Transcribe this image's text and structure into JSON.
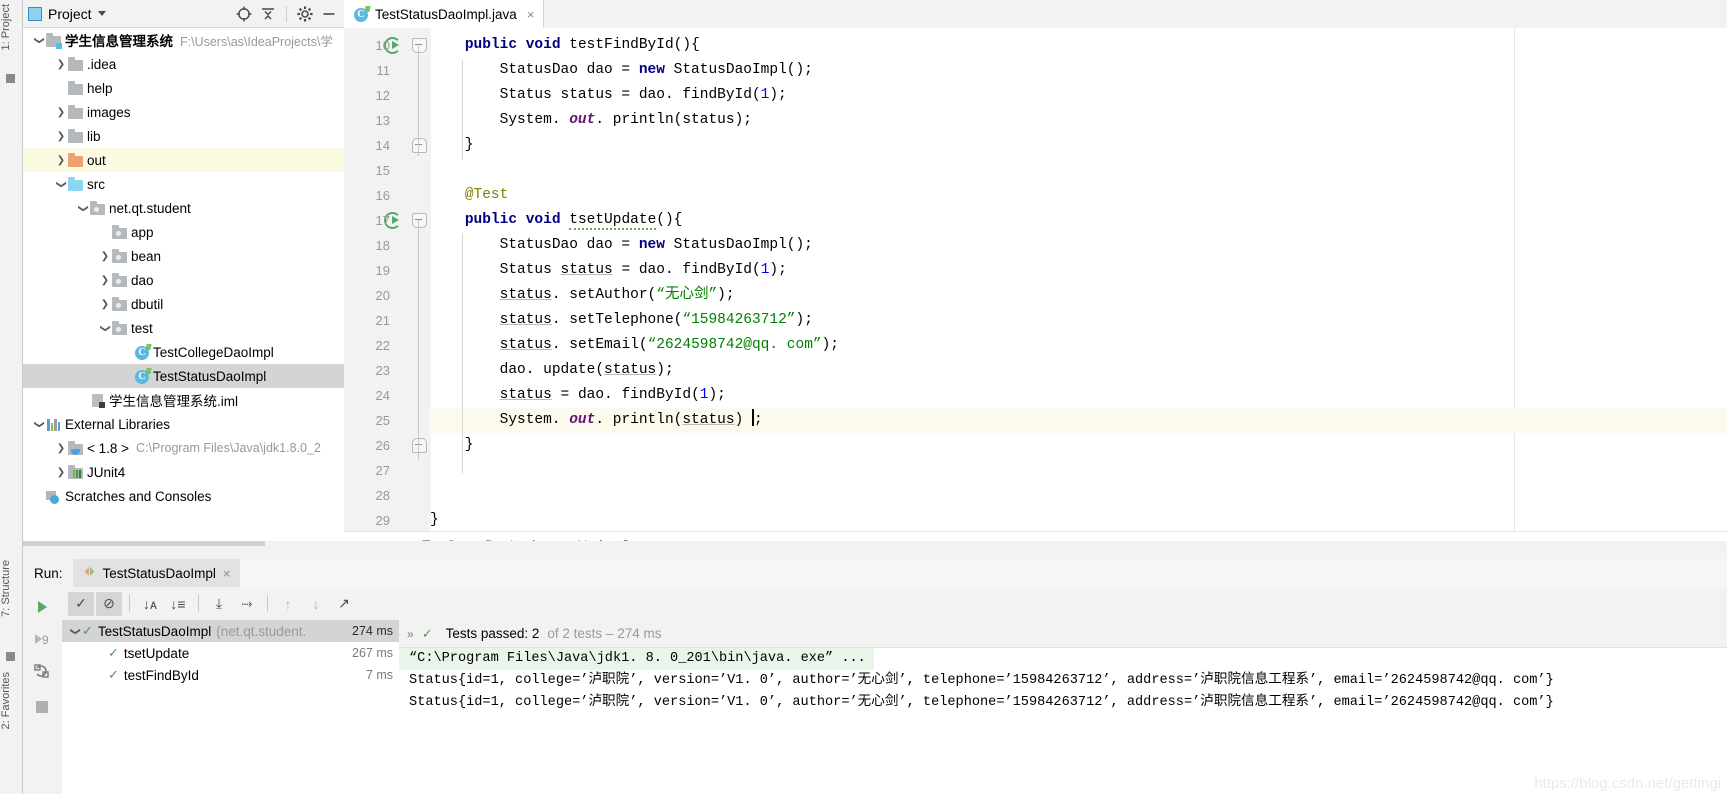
{
  "leftstrip": {
    "items": [
      {
        "name": "project-tool-label",
        "label": "1: Project"
      },
      {
        "name": "structure-tool-label",
        "label": "7: Structure"
      },
      {
        "name": "favorites-tool-label",
        "label": "2: Favorites"
      }
    ]
  },
  "project_panel": {
    "title": "Project",
    "icons": [
      "locate-icon",
      "collapse-all-icon",
      "gear-icon",
      "hide-icon"
    ],
    "tree": [
      {
        "indent": 0,
        "arrow": "down",
        "icon": "folder-module-icon",
        "label": "学生信息管理系统",
        "path": "F:\\Users\\as\\IdeaProjects\\学",
        "bold": true,
        "state": "normal"
      },
      {
        "indent": 1,
        "arrow": "right",
        "icon": "folder-icon",
        "label": ".idea",
        "path": "",
        "bold": false,
        "state": "normal"
      },
      {
        "indent": 1,
        "arrow": "none",
        "icon": "folder-icon",
        "label": "help",
        "path": "",
        "bold": false,
        "state": "normal"
      },
      {
        "indent": 1,
        "arrow": "right",
        "icon": "folder-icon",
        "label": "images",
        "path": "",
        "bold": false,
        "state": "normal"
      },
      {
        "indent": 1,
        "arrow": "right",
        "icon": "folder-icon",
        "label": "lib",
        "path": "",
        "bold": false,
        "state": "normal"
      },
      {
        "indent": 1,
        "arrow": "right",
        "icon": "folder-output-icon",
        "label": "out",
        "path": "",
        "bold": false,
        "state": "highlight"
      },
      {
        "indent": 1,
        "arrow": "down",
        "icon": "folder-source-icon",
        "label": "src",
        "path": "",
        "bold": false,
        "state": "normal"
      },
      {
        "indent": 2,
        "arrow": "down",
        "icon": "package-icon",
        "label": "net.qt.student",
        "path": "",
        "bold": false,
        "state": "normal"
      },
      {
        "indent": 3,
        "arrow": "none",
        "icon": "package-icon",
        "label": "app",
        "path": "",
        "bold": false,
        "state": "normal"
      },
      {
        "indent": 3,
        "arrow": "right",
        "icon": "package-icon",
        "label": "bean",
        "path": "",
        "bold": false,
        "state": "normal"
      },
      {
        "indent": 3,
        "arrow": "right",
        "icon": "package-icon",
        "label": "dao",
        "path": "",
        "bold": false,
        "state": "normal"
      },
      {
        "indent": 3,
        "arrow": "right",
        "icon": "package-icon",
        "label": "dbutil",
        "path": "",
        "bold": false,
        "state": "normal"
      },
      {
        "indent": 3,
        "arrow": "down",
        "icon": "package-icon",
        "label": "test",
        "path": "",
        "bold": false,
        "state": "normal"
      },
      {
        "indent": 4,
        "arrow": "none",
        "icon": "java-class-icon",
        "label": "TestCollegeDaoImpl",
        "path": "",
        "bold": false,
        "state": "normal"
      },
      {
        "indent": 4,
        "arrow": "none",
        "icon": "java-class-icon",
        "label": "TestStatusDaoImpl",
        "path": "",
        "bold": false,
        "state": "selected"
      },
      {
        "indent": 2,
        "arrow": "none",
        "icon": "iml-file-icon",
        "label": "学生信息管理系统.iml",
        "path": "",
        "bold": false,
        "state": "normal"
      },
      {
        "indent": 0,
        "arrow": "down",
        "icon": "external-libraries-icon",
        "label": "External Libraries",
        "path": "",
        "bold": false,
        "state": "normal"
      },
      {
        "indent": 1,
        "arrow": "right",
        "icon": "jdk-icon",
        "label": "< 1.8 >",
        "path": "C:\\Program Files\\Java\\jdk1.8.0_2",
        "bold": false,
        "state": "normal"
      },
      {
        "indent": 1,
        "arrow": "right",
        "icon": "junit-icon",
        "label": "JUnit4",
        "path": "",
        "bold": false,
        "state": "normal"
      },
      {
        "indent": 0,
        "arrow": "none",
        "icon": "scratches-icon",
        "label": "Scratches and Consoles",
        "path": "",
        "bold": false,
        "state": "normal"
      }
    ]
  },
  "editor": {
    "tab": {
      "label": "TestStatusDaoImpl.java",
      "icon": "java-class-icon",
      "close": "×"
    },
    "lines": [
      {
        "n": "10",
        "html": "    <span class=\"kw\">public</span> <span class=\"kw\">void</span> testFindById(){",
        "gutter": "run",
        "fold": "top",
        "caret": false
      },
      {
        "n": "11",
        "html": "        StatusDao dao = <span class=\"kw\">new</span> StatusDaoImpl();",
        "gutter": "",
        "fold": "",
        "caret": false
      },
      {
        "n": "12",
        "html": "        Status status = dao. findById(<span class=\"num\">1</span>);",
        "gutter": "",
        "fold": "",
        "caret": false
      },
      {
        "n": "13",
        "html": "        System. <span class=\"stat\">out</span>. println(status);",
        "gutter": "",
        "fold": "",
        "caret": false
      },
      {
        "n": "14",
        "html": "    }",
        "gutter": "",
        "fold": "bottom",
        "caret": false
      },
      {
        "n": "15",
        "html": "",
        "gutter": "",
        "fold": "",
        "caret": false
      },
      {
        "n": "16",
        "html": "    <span class=\"anno\">@Test</span>",
        "gutter": "",
        "fold": "",
        "caret": false
      },
      {
        "n": "17",
        "html": "    <span class=\"kw\">public</span> <span class=\"kw\">void</span> <span class=\"typo\">tsetUpdate</span>(){",
        "gutter": "run",
        "fold": "top",
        "caret": false
      },
      {
        "n": "18",
        "html": "        StatusDao dao = <span class=\"kw\">new</span> StatusDaoImpl();",
        "gutter": "",
        "fold": "",
        "caret": false
      },
      {
        "n": "19",
        "html": "        Status <span class=\"fld\">status</span> = dao. findById(<span class=\"num\">1</span>);",
        "gutter": "",
        "fold": "",
        "caret": false
      },
      {
        "n": "20",
        "html": "        <span class=\"fld\">status</span>. setAuthor(<span class=\"str\">&ldquo;无心剑&rdquo;</span>);",
        "gutter": "",
        "fold": "",
        "caret": false
      },
      {
        "n": "21",
        "html": "        <span class=\"fld\">status</span>. setTelephone(<span class=\"str\">&ldquo;15984263712&rdquo;</span>);",
        "gutter": "",
        "fold": "",
        "caret": false
      },
      {
        "n": "22",
        "html": "        <span class=\"fld\">status</span>. setEmail(<span class=\"str\">&ldquo;2624598742@qq. com&rdquo;</span>);",
        "gutter": "",
        "fold": "",
        "caret": false
      },
      {
        "n": "23",
        "html": "        dao. update(<span class=\"fld\">status</span>);",
        "gutter": "",
        "fold": "",
        "caret": false
      },
      {
        "n": "24",
        "html": "        <span class=\"fld\">status</span> = dao. findById(<span class=\"num\">1</span>);",
        "gutter": "",
        "fold": "",
        "caret": false
      },
      {
        "n": "25",
        "html": "        System. <span class=\"stat\">out</span>. println(<span class=\"fld\">status</span>) <span class=\"caret\"></span>;",
        "gutter": "",
        "fold": "",
        "caret": true
      },
      {
        "n": "26",
        "html": "    }",
        "gutter": "",
        "fold": "bottom",
        "caret": false
      },
      {
        "n": "27",
        "html": "",
        "gutter": "",
        "fold": "",
        "caret": false
      },
      {
        "n": "28",
        "html": "",
        "gutter": "",
        "fold": "",
        "caret": false
      },
      {
        "n": "29",
        "html": "}",
        "gutter": "",
        "fold": "",
        "caret": false
      }
    ],
    "breadcrumb": {
      "class": "TestStatusDaoImpl",
      "sep": "›",
      "method": "tsetUpdate()"
    }
  },
  "run_panel": {
    "label": "Run:",
    "tab": {
      "label": "TestStatusDaoImpl",
      "close": "×",
      "icon": "run-config-icon"
    },
    "side_buttons": [
      "rerun-icon",
      "rerun-failed-icon",
      "toggle-auto-test-icon",
      "stop-icon"
    ],
    "toolbar": [
      {
        "name": "show-passed-button",
        "glyph": "✓",
        "pressed": true
      },
      {
        "name": "hide-ignored-button",
        "glyph": "⊘",
        "pressed": true
      },
      {
        "name": "sort-alphabetically-button",
        "glyph": "↓ᴀ",
        "pressed": false
      },
      {
        "name": "sort-by-duration-button",
        "glyph": "↓≡",
        "pressed": false
      },
      {
        "name": "expand-all-button",
        "glyph": "⤓",
        "pressed": false
      },
      {
        "name": "collapse-all-button",
        "glyph": "⤑",
        "pressed": false
      },
      {
        "name": "previous-failed-button",
        "glyph": "↑",
        "pressed": false
      },
      {
        "name": "next-failed-button",
        "glyph": "↓",
        "pressed": false
      },
      {
        "name": "export-button",
        "glyph": "↗",
        "pressed": false
      }
    ],
    "tests": [
      {
        "arrow": "down",
        "label": "TestStatusDaoImpl",
        "suffix": "(net.qt.student.",
        "ms": "274 ms",
        "selected": true,
        "indent": 0
      },
      {
        "arrow": "none",
        "label": "tsetUpdate",
        "suffix": "",
        "ms": "267 ms",
        "selected": false,
        "indent": 1
      },
      {
        "arrow": "none",
        "label": "testFindById",
        "suffix": "",
        "ms": "7 ms",
        "selected": false,
        "indent": 1
      }
    ],
    "status": {
      "chevrons": "»",
      "passed_label": "Tests passed: 2",
      "of_label": "of 2 tests – 274 ms"
    },
    "console": [
      {
        "text": "“C:\\Program Files\\Java\\jdk1. 8. 0_201\\bin\\java. exe” ...",
        "cmd": true
      },
      {
        "text": "Status{id=1, college=’泸职院’, version=’V1. 0’, author=’无心剑’, telephone=’15984263712’, address=’泸职院信息工程系’, email=’2624598742@qq. com’}",
        "cmd": false
      },
      {
        "text": "Status{id=1, college=’泸职院’, version=’V1. 0’, author=’无心剑’, telephone=’15984263712’, address=’泸职院信息工程系’, email=’2624598742@qq. com’}",
        "cmd": false
      }
    ],
    "watermark": "https://blog.csdn.net/gettingi"
  },
  "colors": {
    "accent_green": "#59a869",
    "keyword_blue": "#000080",
    "string_green": "#008000",
    "selection_grey": "#d4d4d4"
  }
}
